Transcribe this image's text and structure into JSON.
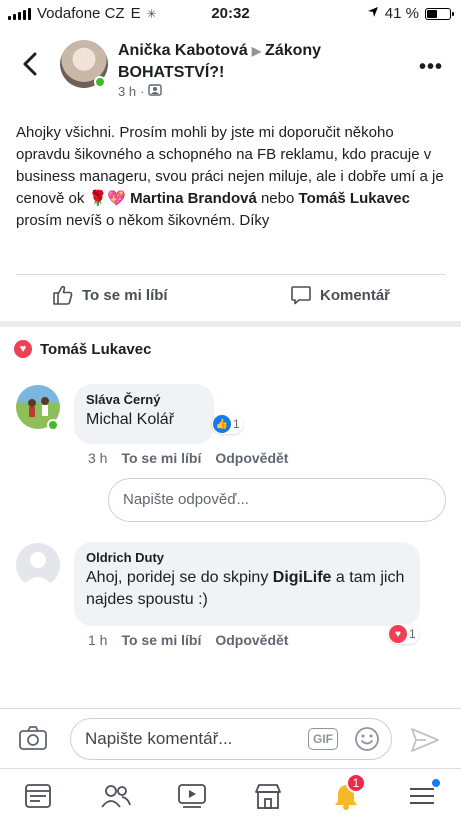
{
  "status_bar": {
    "carrier": "Vodafone CZ",
    "network": "E",
    "time": "20:32",
    "battery_percent_label": "41 %",
    "battery_level": 0.41
  },
  "header": {
    "author": "Anička Kabotová",
    "group": "Zákony BOHATSTVÍ?!",
    "time": "3 h",
    "separator": "·"
  },
  "post": {
    "text_1": "Ahojky všichni. Prosím mohli by jste mi doporučit někoho opravdu šikovného a schopného na FB reklamu, kdo pracuje v business manageru, svou práci nejen miluje, ale i dobře umí a je cenově ok",
    "emoji": "🌹💖",
    "mention_1": "Martina Brandová",
    "connector": "nebo",
    "mention_2": "Tomáš Lukavec",
    "text_2": "prosím nevíš o někom šikovném. Díky"
  },
  "actions": {
    "like": "To se mi líbí",
    "comment": "Komentář"
  },
  "reactions": {
    "reactor": "Tomáš Lukavec"
  },
  "comments": [
    {
      "author": "Sláva Černý",
      "text": "Michal Kolář",
      "reaction_count": "1",
      "time": "3 h",
      "like": "To se mi líbí",
      "reply": "Odpovědět"
    },
    {
      "author": "Oldrich Duty",
      "text_1": "Ahoj, poridej se do skpiny",
      "highlight": "DigiLife",
      "text_2": "a tam jich najdes spoustu :)",
      "reaction_count": "1",
      "time": "1 h",
      "like": "To se mi líbí",
      "reply": "Odpovědět"
    }
  ],
  "reply_box": {
    "placeholder": "Napište odpověď..."
  },
  "composer": {
    "placeholder": "Napište komentář...",
    "gif": "GIF"
  },
  "tabbar": {
    "notifications_count": "1"
  },
  "colors": {
    "online": "#42b72a",
    "like_blue": "#1877f2",
    "love_red": "#f33e58",
    "badge_red": "#f02849"
  }
}
